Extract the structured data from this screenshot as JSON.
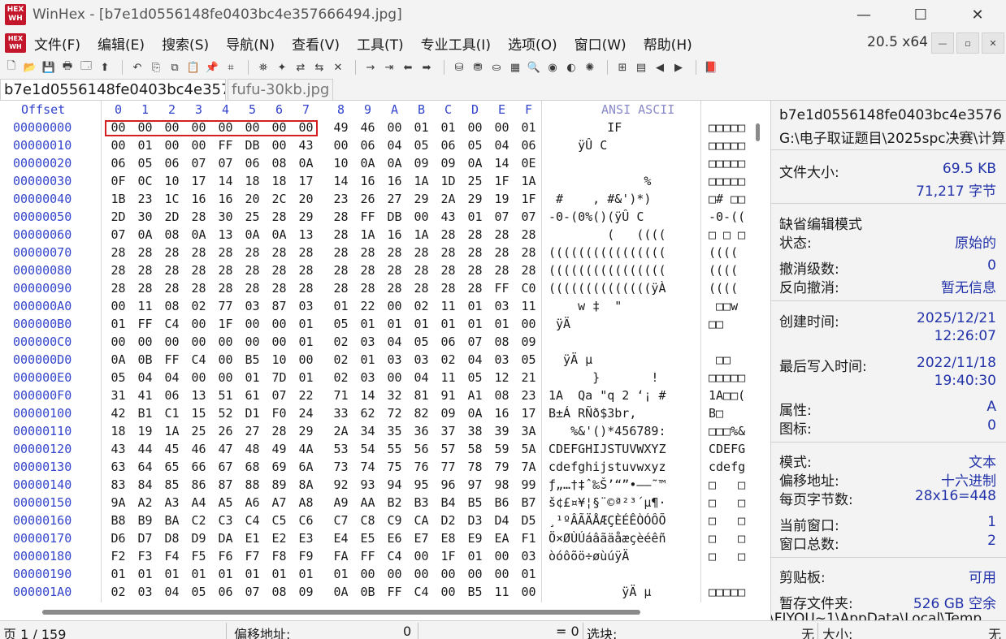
{
  "window": {
    "logo_top": "HEX",
    "logo_bottom": "WH",
    "title": "WinHex - [b7e1d0556148fe0403bc4e357666494.jpg]",
    "minimize": "—",
    "maximize": "☐",
    "close": "✕"
  },
  "menu": {
    "items": [
      "文件(F)",
      "编辑(E)",
      "搜索(S)",
      "导航(N)",
      "查看(V)",
      "工具(T)",
      "专业工具(I)",
      "选项(O)",
      "窗口(W)",
      "帮助(H)"
    ],
    "zoom": "20.5 x64",
    "mdi_min": "—",
    "mdi_restore": "▫",
    "mdi_close": "✕"
  },
  "toolbar": {
    "icons": [
      "new-file-icon",
      "open-folder-icon",
      "save-icon",
      "print-icon",
      "properties-icon",
      "export-icon",
      "|",
      "undo-icon",
      "copy-icon",
      "copy-block-icon",
      "paste-icon",
      "paste-write-icon",
      "hex-copy-icon",
      "|",
      "find-icon",
      "find-hex-icon",
      "replace-icon",
      "replace-hex-icon",
      "find-next-icon",
      "|",
      "goto-offset-icon",
      "goto-sector-icon",
      "back-icon",
      "forward-icon",
      "|",
      "disk-icon",
      "ram-icon",
      "drive-icon",
      "calculator-icon",
      "search-drive-icon",
      "hash-icon",
      "web-icon",
      "gear-icon",
      "|",
      "template-icon",
      "table-icon",
      "mark-prev-icon",
      "mark-next-icon",
      "|",
      "book-icon"
    ],
    "glyphs": [
      "🗋",
      "📂",
      "💾",
      "🖶",
      "🗔",
      "⬆",
      "",
      "↶",
      "⎘",
      "⧉",
      "📋",
      "📌",
      "⌗",
      "",
      "⛯",
      "✦",
      "⇄",
      "⇆",
      "✕",
      "",
      "→",
      "⇥",
      "⬅",
      "➡",
      "",
      "⛁",
      "⛃",
      "⛀",
      "▦",
      "🔍",
      "◉",
      "◐",
      "✺",
      "",
      "⊞",
      "▤",
      "◀",
      "▶",
      "",
      "📕"
    ]
  },
  "tabs": {
    "active": "b7e1d0556148fe0403bc4e357666494.jpg",
    "inactive": "fufu-30kb.jpg"
  },
  "hex": {
    "offset_header": "Offset",
    "col_headers": [
      "0",
      "1",
      "2",
      "3",
      "4",
      "5",
      "6",
      "7",
      "8",
      "9",
      "A",
      "B",
      "C",
      "D",
      "E",
      "F"
    ],
    "ansi_header": "ANSI ASCII",
    "rows": [
      {
        "offset": "00000000",
        "bytes": [
          "00",
          "00",
          "00",
          "00",
          "00",
          "00",
          "00",
          "00",
          "49",
          "46",
          "00",
          "01",
          "01",
          "00",
          "00",
          "01"
        ],
        "ansi": "        IF",
        "ascii": "□□□□□"
      },
      {
        "offset": "00000010",
        "bytes": [
          "00",
          "01",
          "00",
          "00",
          "FF",
          "DB",
          "00",
          "43",
          "00",
          "06",
          "04",
          "05",
          "06",
          "05",
          "04",
          "06"
        ],
        "ansi": "    ÿÛ C",
        "ascii": "□□□□□"
      },
      {
        "offset": "00000020",
        "bytes": [
          "06",
          "05",
          "06",
          "07",
          "07",
          "06",
          "08",
          "0A",
          "10",
          "0A",
          "0A",
          "09",
          "09",
          "0A",
          "14",
          "0E"
        ],
        "ansi": "",
        "ascii": "□□□□□"
      },
      {
        "offset": "00000030",
        "bytes": [
          "0F",
          "0C",
          "10",
          "17",
          "14",
          "18",
          "18",
          "17",
          "14",
          "16",
          "16",
          "1A",
          "1D",
          "25",
          "1F",
          "1A"
        ],
        "ansi": "             %",
        "ascii": "□□□□□"
      },
      {
        "offset": "00000040",
        "bytes": [
          "1B",
          "23",
          "1C",
          "16",
          "16",
          "20",
          "2C",
          "20",
          "23",
          "26",
          "27",
          "29",
          "2A",
          "29",
          "19",
          "1F"
        ],
        "ansi": " #    , #&')*)",
        "ascii": "□# □□"
      },
      {
        "offset": "00000050",
        "bytes": [
          "2D",
          "30",
          "2D",
          "28",
          "30",
          "25",
          "28",
          "29",
          "28",
          "FF",
          "DB",
          "00",
          "43",
          "01",
          "07",
          "07"
        ],
        "ansi": "-0-(0%()(ÿÛ C",
        "ascii": "-0-(("
      },
      {
        "offset": "00000060",
        "bytes": [
          "07",
          "0A",
          "08",
          "0A",
          "13",
          "0A",
          "0A",
          "13",
          "28",
          "1A",
          "16",
          "1A",
          "28",
          "28",
          "28",
          "28"
        ],
        "ansi": "        (   ((((",
        "ascii": "□ □ □"
      },
      {
        "offset": "00000070",
        "bytes": [
          "28",
          "28",
          "28",
          "28",
          "28",
          "28",
          "28",
          "28",
          "28",
          "28",
          "28",
          "28",
          "28",
          "28",
          "28",
          "28"
        ],
        "ansi": "((((((((((((((((",
        "ascii": "(((("
      },
      {
        "offset": "00000080",
        "bytes": [
          "28",
          "28",
          "28",
          "28",
          "28",
          "28",
          "28",
          "28",
          "28",
          "28",
          "28",
          "28",
          "28",
          "28",
          "28",
          "28"
        ],
        "ansi": "((((((((((((((((",
        "ascii": "(((("
      },
      {
        "offset": "00000090",
        "bytes": [
          "28",
          "28",
          "28",
          "28",
          "28",
          "28",
          "28",
          "28",
          "28",
          "28",
          "28",
          "28",
          "28",
          "28",
          "FF",
          "C0"
        ],
        "ansi": "((((((((((((((ÿÀ",
        "ascii": "(((("
      },
      {
        "offset": "000000A0",
        "bytes": [
          "00",
          "11",
          "08",
          "02",
          "77",
          "03",
          "87",
          "03",
          "01",
          "22",
          "00",
          "02",
          "11",
          "01",
          "03",
          "11"
        ],
        "ansi": "    w ‡  \"",
        "ascii": " □□w"
      },
      {
        "offset": "000000B0",
        "bytes": [
          "01",
          "FF",
          "C4",
          "00",
          "1F",
          "00",
          "00",
          "01",
          "05",
          "01",
          "01",
          "01",
          "01",
          "01",
          "01",
          "00"
        ],
        "ansi": " ÿÄ",
        "ascii": "□□"
      },
      {
        "offset": "000000C0",
        "bytes": [
          "00",
          "00",
          "00",
          "00",
          "00",
          "00",
          "00",
          "01",
          "02",
          "03",
          "04",
          "05",
          "06",
          "07",
          "08",
          "09"
        ],
        "ansi": "",
        "ascii": ""
      },
      {
        "offset": "000000D0",
        "bytes": [
          "0A",
          "0B",
          "FF",
          "C4",
          "00",
          "B5",
          "10",
          "00",
          "02",
          "01",
          "03",
          "03",
          "02",
          "04",
          "03",
          "05"
        ],
        "ansi": "  ÿÄ µ",
        "ascii": " □□"
      },
      {
        "offset": "000000E0",
        "bytes": [
          "05",
          "04",
          "04",
          "00",
          "00",
          "01",
          "7D",
          "01",
          "02",
          "03",
          "00",
          "04",
          "11",
          "05",
          "12",
          "21"
        ],
        "ansi": "      }       !",
        "ascii": "□□□□□"
      },
      {
        "offset": "000000F0",
        "bytes": [
          "31",
          "41",
          "06",
          "13",
          "51",
          "61",
          "07",
          "22",
          "71",
          "14",
          "32",
          "81",
          "91",
          "A1",
          "08",
          "23"
        ],
        "ansi": "1A  Qa \"q 2 ‘¡ #",
        "ascii": "1A□□("
      },
      {
        "offset": "00000100",
        "bytes": [
          "42",
          "B1",
          "C1",
          "15",
          "52",
          "D1",
          "F0",
          "24",
          "33",
          "62",
          "72",
          "82",
          "09",
          "0A",
          "16",
          "17"
        ],
        "ansi": "B±Á RÑð$3br,",
        "ascii": "B□"
      },
      {
        "offset": "00000110",
        "bytes": [
          "18",
          "19",
          "1A",
          "25",
          "26",
          "27",
          "28",
          "29",
          "2A",
          "34",
          "35",
          "36",
          "37",
          "38",
          "39",
          "3A"
        ],
        "ansi": "   %&'()*456789:",
        "ascii": "□□□%&"
      },
      {
        "offset": "00000120",
        "bytes": [
          "43",
          "44",
          "45",
          "46",
          "47",
          "48",
          "49",
          "4A",
          "53",
          "54",
          "55",
          "56",
          "57",
          "58",
          "59",
          "5A"
        ],
        "ansi": "CDEFGHIJSTUVWXYZ",
        "ascii": "CDEFG"
      },
      {
        "offset": "00000130",
        "bytes": [
          "63",
          "64",
          "65",
          "66",
          "67",
          "68",
          "69",
          "6A",
          "73",
          "74",
          "75",
          "76",
          "77",
          "78",
          "79",
          "7A"
        ],
        "ansi": "cdefghijstuvwxyz",
        "ascii": "cdefg"
      },
      {
        "offset": "00000140",
        "bytes": [
          "83",
          "84",
          "85",
          "86",
          "87",
          "88",
          "89",
          "8A",
          "92",
          "93",
          "94",
          "95",
          "96",
          "97",
          "98",
          "99"
        ],
        "ansi": "ƒ„…†‡ˆ‰Š’“”•–—˜™",
        "ascii": "□   □"
      },
      {
        "offset": "00000150",
        "bytes": [
          "9A",
          "A2",
          "A3",
          "A4",
          "A5",
          "A6",
          "A7",
          "A8",
          "A9",
          "AA",
          "B2",
          "B3",
          "B4",
          "B5",
          "B6",
          "B7"
        ],
        "ansi": "š¢£¤¥¦§¨©ª²³´µ¶·",
        "ascii": "□   □"
      },
      {
        "offset": "00000160",
        "bytes": [
          "B8",
          "B9",
          "BA",
          "C2",
          "C3",
          "C4",
          "C5",
          "C6",
          "C7",
          "C8",
          "C9",
          "CA",
          "D2",
          "D3",
          "D4",
          "D5"
        ],
        "ansi": "¸¹ºÂÃÄÅÆÇÈÉÊÒÓÔÕ",
        "ascii": "□   □"
      },
      {
        "offset": "00000170",
        "bytes": [
          "D6",
          "D7",
          "D8",
          "D9",
          "DA",
          "E1",
          "E2",
          "E3",
          "E4",
          "E5",
          "E6",
          "E7",
          "E8",
          "E9",
          "EA",
          "F1"
        ],
        "ansi": "Ö×ØÙÚáâãäåæçèéêñ",
        "ascii": "□   □"
      },
      {
        "offset": "00000180",
        "bytes": [
          "F2",
          "F3",
          "F4",
          "F5",
          "F6",
          "F7",
          "F8",
          "F9",
          "FA",
          "FF",
          "C4",
          "00",
          "1F",
          "01",
          "00",
          "03"
        ],
        "ansi": "òóôõö÷øùúÿÄ",
        "ascii": "□   □"
      },
      {
        "offset": "00000190",
        "bytes": [
          "01",
          "01",
          "01",
          "01",
          "01",
          "01",
          "01",
          "01",
          "01",
          "00",
          "00",
          "00",
          "00",
          "00",
          "00",
          "01"
        ],
        "ansi": "",
        "ascii": ""
      },
      {
        "offset": "000001A0",
        "bytes": [
          "02",
          "03",
          "04",
          "05",
          "06",
          "07",
          "08",
          "09",
          "0A",
          "0B",
          "FF",
          "C4",
          "00",
          "B5",
          "11",
          "00"
        ],
        "ansi": "          ÿÄ µ",
        "ascii": "□□□□□"
      }
    ]
  },
  "info": {
    "filename": "b7e1d0556148fe0403bc4e3576",
    "path": "G:\\电子取证题目\\2025spc决赛\\计算",
    "file_size_label": "文件大小:",
    "file_size_kb": "69.5 KB",
    "file_size_bytes": "71,217 字节",
    "edit_mode_label": "缺省编辑模式",
    "state_label": "状态:",
    "state_value": "原始的",
    "undo_count_label": "撤消级数:",
    "undo_count_value": "0",
    "redo_label": "反向撤消:",
    "redo_value": "暂无信息",
    "created_label": "创建时间:",
    "created_date": "2025/12/21",
    "created_time": "12:26:07",
    "modified_label": "最后写入时间:",
    "modified_date": "2022/11/18",
    "modified_time": "19:40:30",
    "attr_label": "属性:",
    "attr_value": "A",
    "icon_label": "图标:",
    "icon_value": "0",
    "mode_label": "模式:",
    "mode_value": "文本",
    "offset_label": "偏移地址:",
    "offset_value": "十六进制",
    "bytes_per_page_label": "每页字节数:",
    "bytes_per_page_value": "28x16=448",
    "current_window_label": "当前窗口:",
    "current_window_value": "1",
    "total_windows_label": "窗口总数:",
    "total_windows_value": "2",
    "clipboard_label": "剪贴板:",
    "clipboard_value": "可用",
    "temp_label": "暂存文件夹:",
    "temp_value": "526 GB 空余",
    "temp_path": "\\FIYOU~1\\AppData\\Local\\Temp"
  },
  "status": {
    "page": "页 1 / 159",
    "offset_label": "偏移地址:",
    "offset_value": "0",
    "eq_value": "= 0",
    "block_label": "选块:",
    "block_value": "无",
    "size_label": "大小:",
    "size_value": "无"
  },
  "colors": {
    "offset_blue": "#3344cc",
    "value_blue": "#2233aa",
    "highlight_red": "#d42020",
    "panel_bg": "#f3f3f3"
  }
}
